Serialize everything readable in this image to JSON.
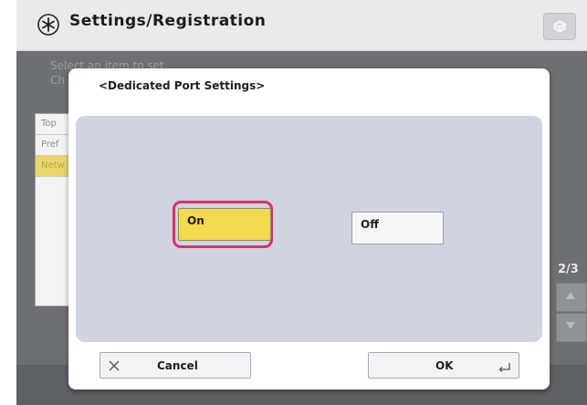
{
  "header": {
    "title": "Settings/Registration",
    "icons": {
      "app": "settings-asterisk-icon",
      "corner": "cube-icon"
    }
  },
  "background": {
    "instruction_line1": "Select an item to set.",
    "instruction_line2": "Ch",
    "list_items": [
      "Top",
      "Pref",
      "Netw"
    ],
    "selected_index": 2,
    "page_indicator": "2/3"
  },
  "dialog": {
    "title": "<Dedicated Port Settings>",
    "options": [
      {
        "label": "On",
        "selected": true
      },
      {
        "label": "Off",
        "selected": false
      }
    ],
    "cancel_label": "Cancel",
    "ok_label": "OK"
  },
  "colors": {
    "selected_option": "#f3d94c",
    "selection_outline": "#d6336c",
    "panel": "#cfd4e0",
    "dim_overlay": "#6d7073"
  }
}
